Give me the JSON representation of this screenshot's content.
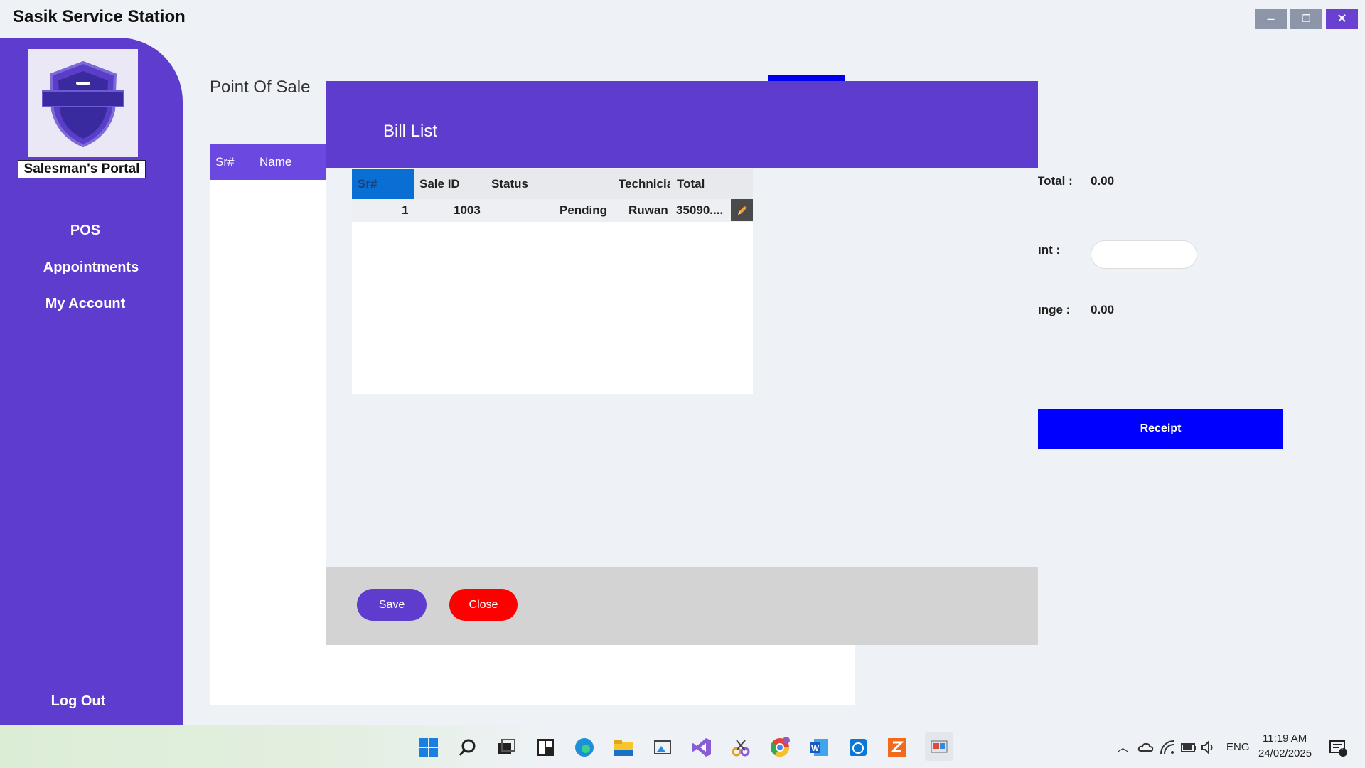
{
  "window": {
    "title": "Sasik Service Station",
    "minimize": "–",
    "maximize": "❐",
    "close": "✕"
  },
  "sidebar": {
    "portal_label": "Salesman's Portal",
    "items": [
      {
        "label": "POS"
      },
      {
        "label": "Appointments"
      },
      {
        "label": "My Account"
      }
    ],
    "logout": "Log Out"
  },
  "pos": {
    "title": "Point Of Sale",
    "table_headers": {
      "sr": "Sr#",
      "name": "Name"
    },
    "total_label": "Total :",
    "total_value": "0.00",
    "amount_label": "ınt :",
    "change_label": "ınge :",
    "change_value": "0.00",
    "receipt_button": "Receipt"
  },
  "modal": {
    "title": "Bill List",
    "columns": {
      "sr": "Sr#",
      "sale_id": "Sale ID",
      "status": "Status",
      "technician": "Technicia",
      "total": "Total"
    },
    "rows": [
      {
        "sr": "1",
        "sale_id": "1003",
        "status": "Pending",
        "technician": "Ruwan",
        "total": "35090...."
      }
    ],
    "save_button": "Save",
    "close_button": "Close"
  },
  "taskbar": {
    "language": "ENG",
    "time": "11:19 AM",
    "date": "24/02/2025",
    "notification_count": "1"
  },
  "colors": {
    "primary": "#5d3cce",
    "accent_blue": "#0000ff",
    "danger": "#ff0000"
  }
}
